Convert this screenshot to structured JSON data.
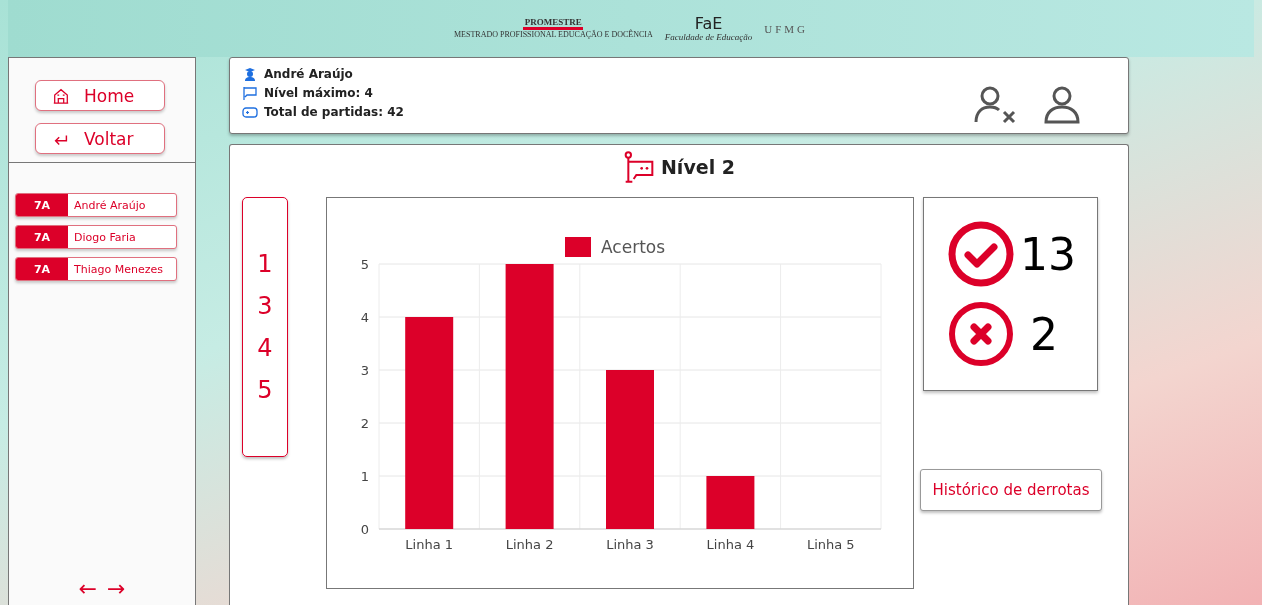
{
  "header": {
    "promestre": {
      "name": "PROMESTRE",
      "subtitle": "MESTRADO PROFISSIONAL EDUCAÇÃO E DOCÊNCIA"
    },
    "fae": {
      "name": "FaE",
      "subtitle": "Faculdade de Educação"
    },
    "ufmg": "UFMG"
  },
  "sidebar": {
    "buttons": [
      {
        "kind": "home",
        "label": "Home"
      },
      {
        "kind": "back",
        "label": "Voltar"
      }
    ],
    "students": [
      {
        "class": "7A",
        "name": "André Araújo"
      },
      {
        "class": "7A",
        "name": "Diogo Faria"
      },
      {
        "class": "7A",
        "name": "Thiago Menezes"
      }
    ],
    "pager": [
      "←",
      "→"
    ]
  },
  "profile": {
    "name": "André Araújo",
    "max_level": "Nível máximo: 4",
    "total_games": "Total de partidas: 42"
  },
  "level_panel": {
    "title": "Nível 2",
    "levels": [
      "1",
      "3",
      "4",
      "5"
    ],
    "chart_data": {
      "type": "bar",
      "categories": [
        "Linha 1",
        "Linha 2",
        "Linha 3",
        "Linha 4",
        "Linha 5"
      ],
      "series": [
        {
          "name": "Acertos",
          "color": "#dc0029",
          "values": [
            4,
            5,
            3,
            1,
            0
          ]
        }
      ],
      "ylim": [
        0,
        5
      ],
      "grid": true,
      "yticks": [
        0,
        1,
        2,
        3,
        4,
        5
      ]
    },
    "correct": "13",
    "wrong": "2",
    "history_button": "Histórico de derrotas"
  }
}
